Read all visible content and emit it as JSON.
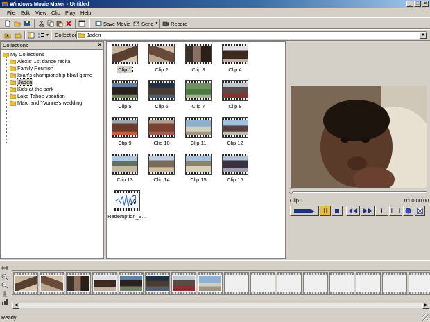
{
  "window": {
    "title": "Windows Movie Maker - Untitled"
  },
  "menu": [
    "File",
    "Edit",
    "View",
    "Clip",
    "Play",
    "Help"
  ],
  "toolbar": {
    "save_movie": "Save Movie",
    "send": "Send",
    "record": "Record"
  },
  "collection_bar": {
    "label": "Collection",
    "value": "Jaden"
  },
  "collections": {
    "header": "Collections",
    "root": "My Collections",
    "items": [
      "Alexis' 1st dance recital",
      "Family Reunion",
      "Isiah's championship bball game",
      "Jaden",
      "Kids at the park",
      "Lake Tahoe vacation",
      "Marc and Yvonne's wedding"
    ],
    "selected": "Jaden"
  },
  "clips": [
    "Clip 1",
    "Clip 2",
    "Clip 3",
    "Clip 4",
    "Clip 5",
    "Clip 6",
    "Clip 7",
    "Clip 8",
    "Clip 9",
    "Clip 10",
    "Clip 11",
    "Clip 12",
    "Clip 13",
    "Clip 14",
    "Clip 15",
    "Clip 16",
    "Redemption_S..."
  ],
  "monitor": {
    "clip_name": "Clip 1",
    "time": "0:00:00.00"
  },
  "status": {
    "text": "Ready"
  },
  "colors": {
    "title_bar": "#0a246a",
    "face": "#d4d0c8",
    "selection_highlight": "#d4d0c8"
  }
}
